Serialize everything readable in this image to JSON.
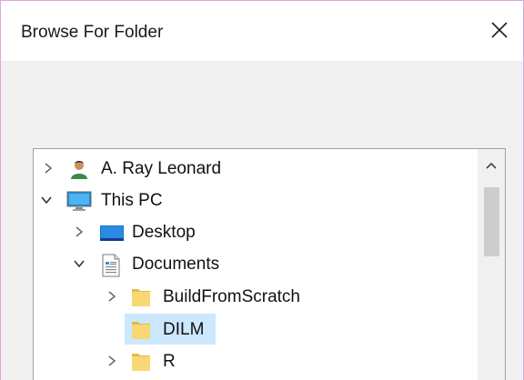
{
  "window": {
    "title": "Browse For Folder",
    "close_icon": "close-icon"
  },
  "tree": {
    "items": [
      {
        "label": "A. Ray Leonard",
        "icon": "user-icon",
        "expanded": false,
        "selected": false
      },
      {
        "label": "This PC",
        "icon": "computer-icon",
        "expanded": true,
        "selected": false
      },
      {
        "label": "Desktop",
        "icon": "desktop-folder-icon",
        "expanded": false,
        "selected": false
      },
      {
        "label": "Documents",
        "icon": "documents-icon",
        "expanded": true,
        "selected": false
      },
      {
        "label": "BuildFromScratch",
        "icon": "folder-icon",
        "expanded": false,
        "selected": false
      },
      {
        "label": "DILM",
        "icon": "folder-icon",
        "expanded": false,
        "selected": true
      },
      {
        "label": "R",
        "icon": "folder-icon",
        "expanded": false,
        "selected": false
      }
    ]
  },
  "colors": {
    "selection": "#cce8ff",
    "folder": "#f8d775",
    "border": "#a0a0a0"
  }
}
